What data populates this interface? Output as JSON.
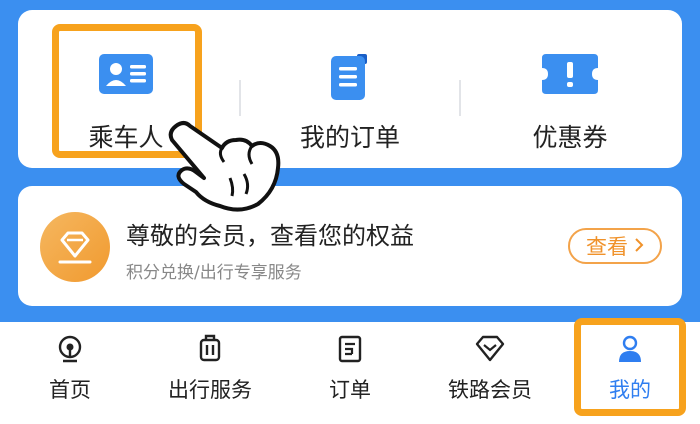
{
  "quick_actions": [
    {
      "label": "乘车人",
      "icon": "passenger-card-icon"
    },
    {
      "label": "我的订单",
      "icon": "order-document-icon"
    },
    {
      "label": "优惠券",
      "icon": "coupon-ticket-icon"
    }
  ],
  "vip": {
    "title": "尊敬的会员，查看您的权益",
    "subtitle": "积分兑换/出行专享服务",
    "button_label": "查看",
    "icon": "diamond-badge-icon"
  },
  "tabs": [
    {
      "label": "首页",
      "icon": "train-home-icon"
    },
    {
      "label": "出行服务",
      "icon": "luggage-icon"
    },
    {
      "label": "订单",
      "icon": "order-list-icon"
    },
    {
      "label": "铁路会员",
      "icon": "diamond-icon"
    },
    {
      "label": "我的",
      "icon": "person-icon"
    }
  ],
  "active_tab": "我的",
  "colors": {
    "background_blue": "#3b8ff0",
    "accent_blue": "#2f7ef0",
    "highlight_orange": "#f7a21d",
    "vip_orange": "#f19a2f"
  }
}
